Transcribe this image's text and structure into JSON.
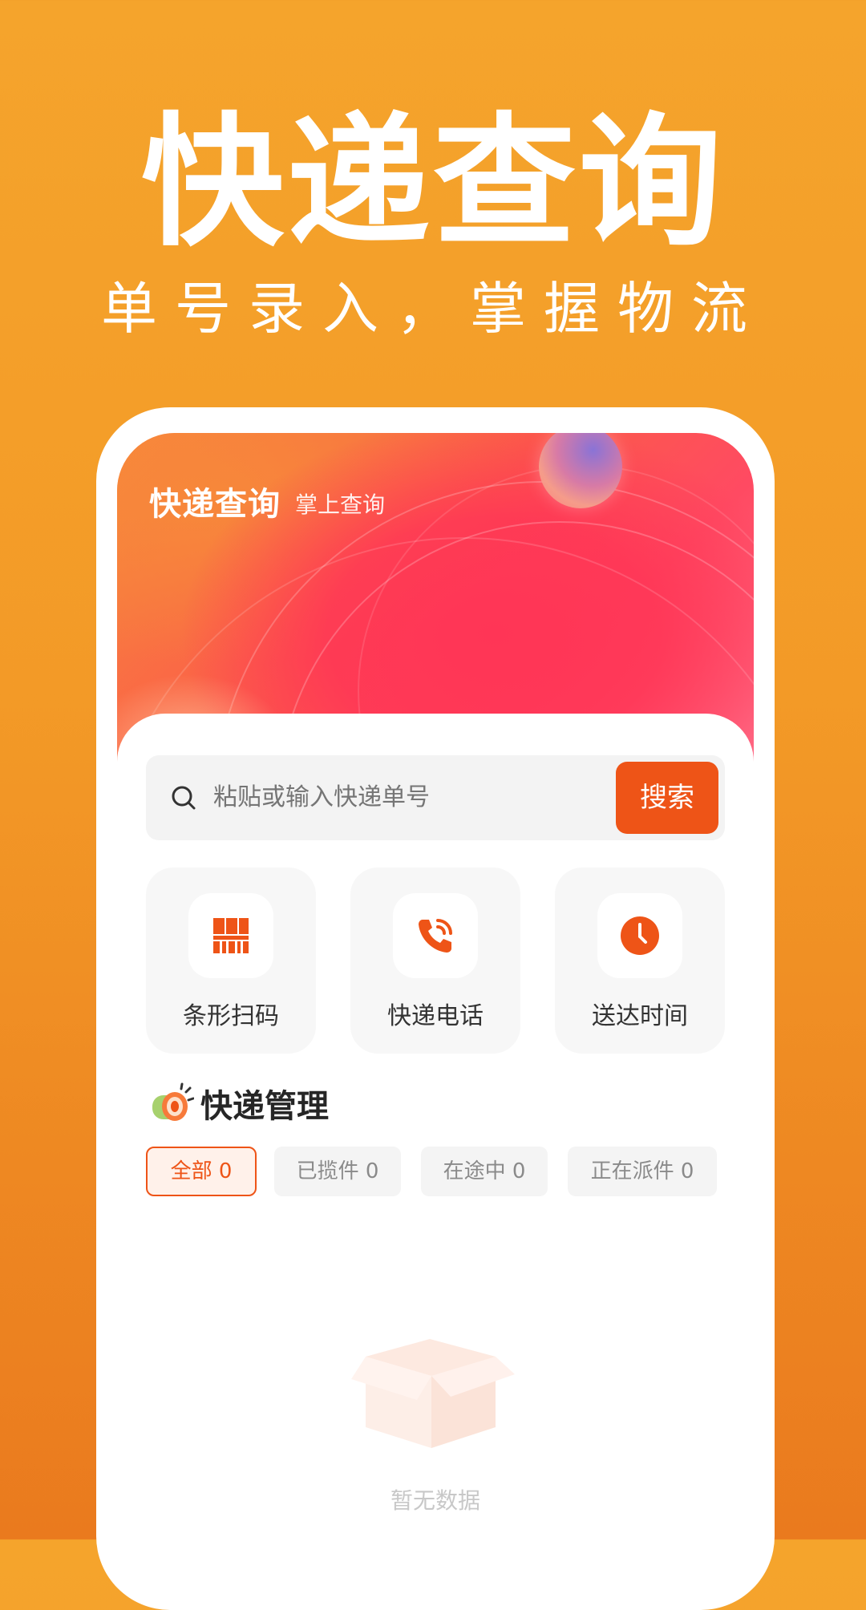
{
  "promo": {
    "title": "快递查询",
    "subtitle": "单号录入，掌握物流"
  },
  "app": {
    "banner_title": "快递查询",
    "banner_subtitle": "掌上查询"
  },
  "search": {
    "placeholder": "粘贴或输入快递单号",
    "button_label": "搜索",
    "icon": "search-icon"
  },
  "features": [
    {
      "label": "条形扫码",
      "icon": "barcode-scan-icon"
    },
    {
      "label": "快递电话",
      "icon": "phone-call-icon"
    },
    {
      "label": "送达时间",
      "icon": "clock-icon"
    }
  ],
  "management": {
    "title": "快递管理",
    "icon": "megaphone-icon"
  },
  "filters": [
    {
      "label": "全部 0",
      "active": true
    },
    {
      "label": "已揽件 0",
      "active": false
    },
    {
      "label": "在途中 0",
      "active": false
    },
    {
      "label": "正在派件 0",
      "active": false
    }
  ],
  "empty_state": {
    "text": "暂无数据",
    "icon": "empty-box-icon"
  },
  "colors": {
    "accent": "#ee5417",
    "background": "#f39a27"
  }
}
